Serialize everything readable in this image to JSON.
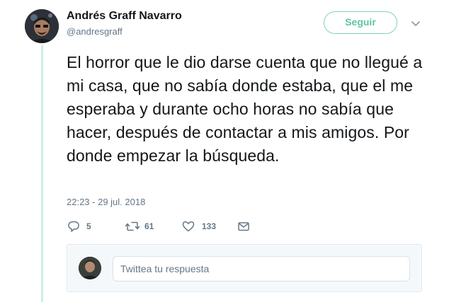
{
  "user": {
    "display_name": "Andrés Graff Navarro",
    "handle": "@andresgraff"
  },
  "follow_button": {
    "label": "Seguir"
  },
  "tweet": {
    "text": "El horror que le dio darse cuenta que no llegué a mi casa, que no sabía donde estaba, que el me esperaba y durante ocho horas no sabía que hacer, después de contactar a mis amigos. Por donde empezar la búsqueda.",
    "timestamp": "22:23 - 29 jul. 2018"
  },
  "actions": {
    "replies": "5",
    "retweets": "61",
    "likes": "133"
  },
  "reply": {
    "placeholder": "Twittea tu respuesta"
  },
  "colors": {
    "accent": "#5fc59f",
    "thread_line": "#c9f0e0",
    "muted": "#657786"
  },
  "icons": [
    "caret-down-icon",
    "reply-icon",
    "retweet-icon",
    "like-icon",
    "message-icon"
  ]
}
